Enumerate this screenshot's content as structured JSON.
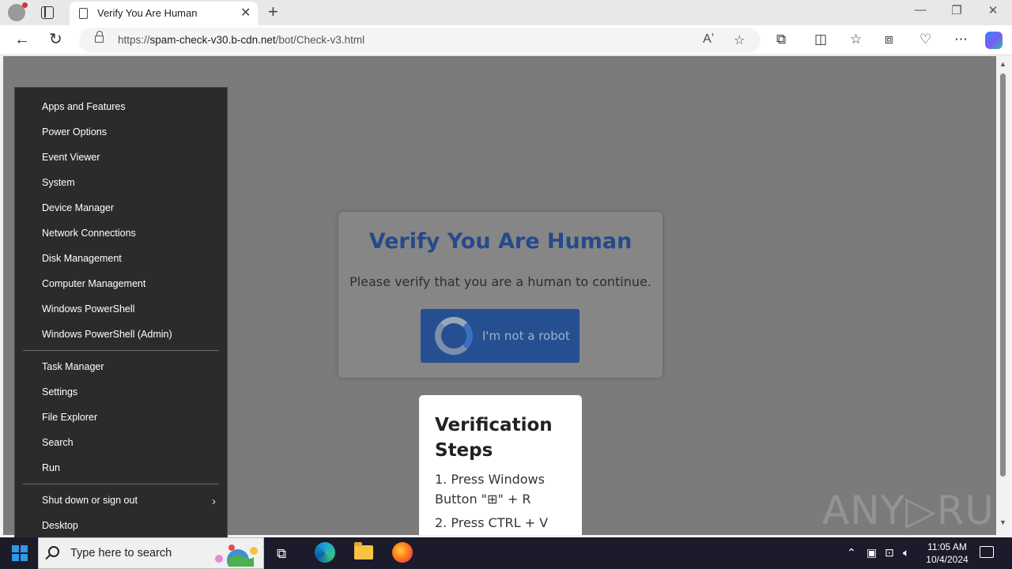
{
  "browser": {
    "tab_title": "Verify You Are Human",
    "tab_close": "✕",
    "new_tab": "+",
    "minimize": "—",
    "restore": "❐",
    "close": "✕",
    "url_prefix": "https://",
    "url_host": "spam-check-v30.b-cdn.net",
    "url_path": "/bot/Check-v3.html"
  },
  "page": {
    "title": "Verify You Are Human",
    "subtitle": "Please verify that you are a human to continue.",
    "button_label": "I'm not a robot",
    "steps_title": "Verification Steps",
    "step1": "1. Press Windows Button \"⊞\" + R",
    "step2": "2. Press CTRL + V"
  },
  "watermark": "ANY▷RUN",
  "context_menu": {
    "group1": [
      "Apps and Features",
      "Power Options",
      "Event Viewer",
      "System",
      "Device Manager",
      "Network Connections",
      "Disk Management",
      "Computer Management",
      "Windows PowerShell",
      "Windows PowerShell (Admin)"
    ],
    "group2": [
      "Task Manager",
      "Settings",
      "File Explorer",
      "Search",
      "Run"
    ],
    "group3": [
      "Shut down or sign out",
      "Desktop"
    ]
  },
  "taskbar": {
    "search_placeholder": "Type here to search",
    "time": "11:05 AM",
    "date": "10/4/2024"
  },
  "colors": {
    "page_title": "#254a8b",
    "button": "#254f91",
    "menu_bg": "#2b2b2b",
    "taskbar": "#1b1b2b"
  }
}
